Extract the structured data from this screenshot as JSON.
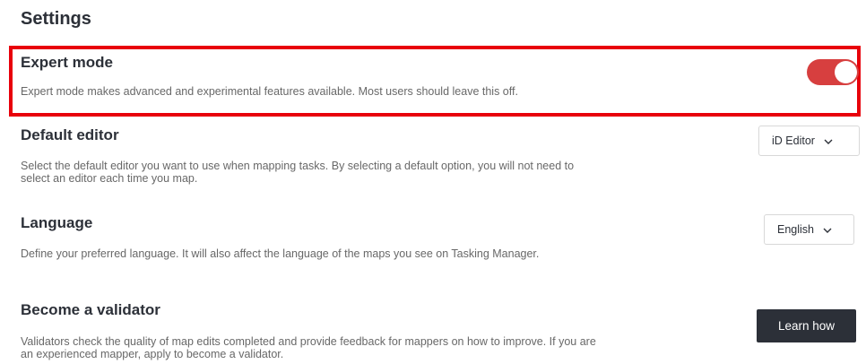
{
  "page": {
    "title": "Settings"
  },
  "settings": {
    "expert_mode": {
      "title": "Expert mode",
      "description": "Expert mode makes advanced and experimental features available. Most users should leave this off.",
      "enabled": true,
      "toggle_color": "#d73f3f"
    },
    "default_editor": {
      "title": "Default editor",
      "description": "Select the default editor you want to use when mapping tasks. By selecting a default option, you will not need to select an editor each time you map.",
      "selected": "iD Editor"
    },
    "language": {
      "title": "Language",
      "description": "Define your preferred language. It will also affect the language of the maps you see on Tasking Manager.",
      "selected": "English"
    },
    "validator": {
      "title": "Become a validator",
      "description": "Validators check the quality of map edits completed and provide feedback for mappers on how to improve. If you are an experienced mapper, apply to become a validator.",
      "button_label": "Learn how"
    }
  },
  "icons": {
    "dropdown": "chevron-down-icon"
  },
  "colors": {
    "highlight": "#e8000b",
    "button_bg": "#2c3038"
  }
}
